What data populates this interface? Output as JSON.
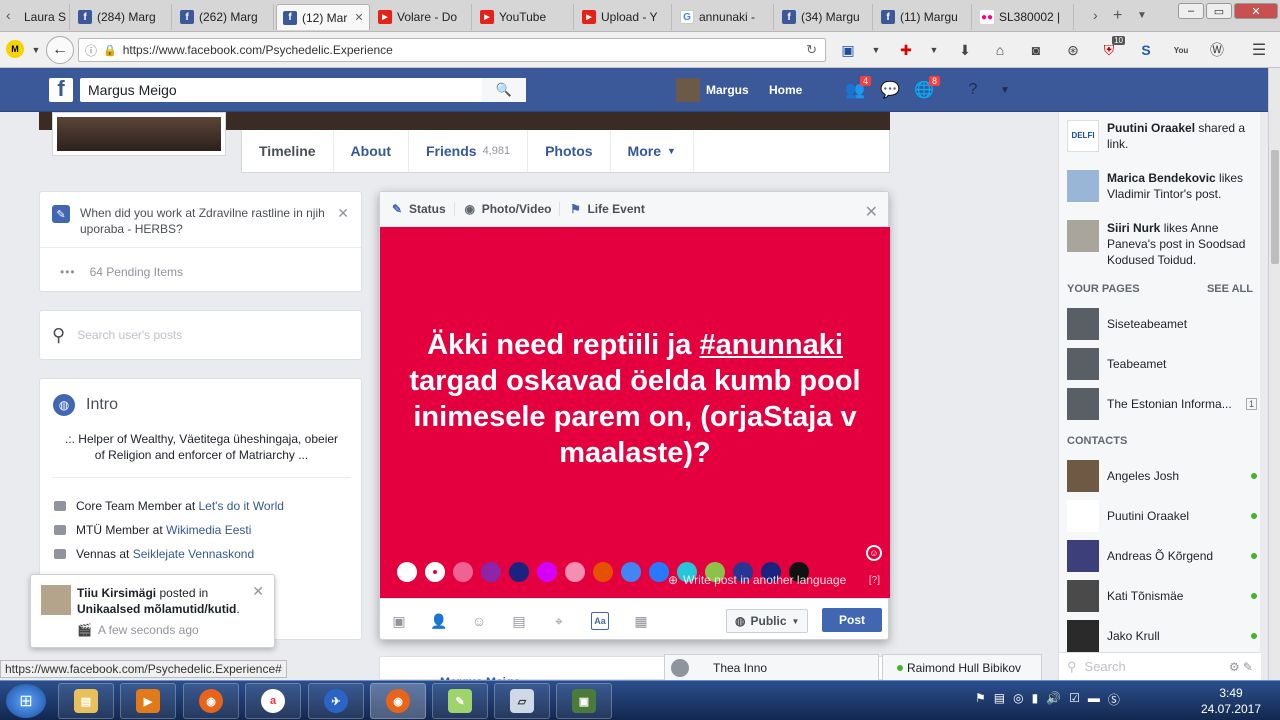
{
  "browser": {
    "tabs": [
      {
        "title": "Laura S",
        "icon": "generic"
      },
      {
        "title": "(284) Marg",
        "icon": "facebook"
      },
      {
        "title": "(262) Marg",
        "icon": "facebook"
      },
      {
        "title": "(12) Mar",
        "icon": "facebook",
        "active": true
      },
      {
        "title": "Volare - Do",
        "icon": "youtube"
      },
      {
        "title": "YouTube",
        "icon": "youtube"
      },
      {
        "title": "Upload - Y",
        "icon": "youtube"
      },
      {
        "title": "annunaki -",
        "icon": "google"
      },
      {
        "title": "(34) Margu",
        "icon": "facebook"
      },
      {
        "title": "(11) Margu",
        "icon": "facebook"
      },
      {
        "title": "SL380002 |",
        "icon": "flickr"
      }
    ],
    "url": "https://www.facebook.com/Psychedelic.Experience",
    "extension_badge": "10"
  },
  "fb_header": {
    "search_value": "Margus Meigo",
    "profile_name": "Margus",
    "home_label": "Home",
    "friend_requests_count": "4",
    "notifications_count": "8"
  },
  "profile_nav": {
    "timeline": "Timeline",
    "about": "About",
    "friends": "Friends",
    "friends_count": "4,981",
    "photos": "Photos",
    "more": "More"
  },
  "left": {
    "work_question": "When did you work at Zdravilne rastline in njih uporaba - HERBS?",
    "pending": "64 Pending Items",
    "search_placeholder": "Search user's posts",
    "intro_title": "Intro",
    "intro_bio": ".:. Helper of Wealthy, Väetitega üheshingaja, obeier of Religion and enforcer of Matriarchy ...",
    "intro_rows": [
      {
        "prefix": "Core Team Member at ",
        "link": "Let's do it World"
      },
      {
        "prefix": "MTÜ Member at ",
        "link": "Wikimedia Eesti"
      },
      {
        "prefix": "Vennas at ",
        "link": "Seiklejate Vennaskond"
      }
    ]
  },
  "toast": {
    "name": "Tiiu Kirsimägi",
    "action": " posted in ",
    "group": "Unikaalsed mõlamutid/kutid",
    "time": "A few seconds ago"
  },
  "status_link": "https://www.facebook.com/Psychedelic.Experience#",
  "composer": {
    "tab_status": "Status",
    "tab_photo": "Photo/Video",
    "tab_life": "Life Event",
    "text_before": "Äkki need reptiili ja ",
    "hashtag": "#anunnaki",
    "text_after": " targad oskavad öelda kumb pool inimesele parem on, (orjaStaja v maalaste)?",
    "background_color": "#e4003f",
    "swatch_colors": [
      "#ffffff",
      "#e4003f",
      "#f06292",
      "#8e24aa",
      "#1a237e",
      "#d500f9",
      "#f48fb1",
      "#e65100",
      "#4285f4",
      "#2979ff",
      "#26c6da",
      "#8bc34a",
      "#283593",
      "#1a237e",
      "#111111"
    ],
    "lang_link": "Write post in another language",
    "lang_help": "[?]",
    "audience": "Public",
    "post_label": "Post"
  },
  "feed_strip": {
    "name": "Margus Meigo"
  },
  "chat_tabs": {
    "tab1": "Thea Inno",
    "tab2": "Raimond Hull Bibikov"
  },
  "right": {
    "ticker": [
      {
        "actor": "Puutini Oraakel",
        "text": " shared a link."
      },
      {
        "actor": "Marica Bendekovic",
        "text": " likes Vladimir Tintor's post."
      },
      {
        "actor": "Siiri Nurk",
        "text": " likes Anne Paneva's post in Soodsad Kodused Toidud."
      }
    ],
    "pages_title": "YOUR PAGES",
    "see_all": "SEE ALL",
    "pages": [
      {
        "name": "Siseteabeamet"
      },
      {
        "name": "Teabeamet"
      },
      {
        "name": "The Estonian Informa...",
        "badge": "1"
      }
    ],
    "contacts_title": "CONTACTS",
    "contacts": [
      "Angeles Josh",
      "Puutini Oraakel",
      "Andreas Õ Kõrgend",
      "Kati Tõnismäe",
      "Jako Krull"
    ],
    "search_placeholder": "Search"
  },
  "taskbar": {
    "time": "3:49",
    "date": "24.07.2017"
  }
}
